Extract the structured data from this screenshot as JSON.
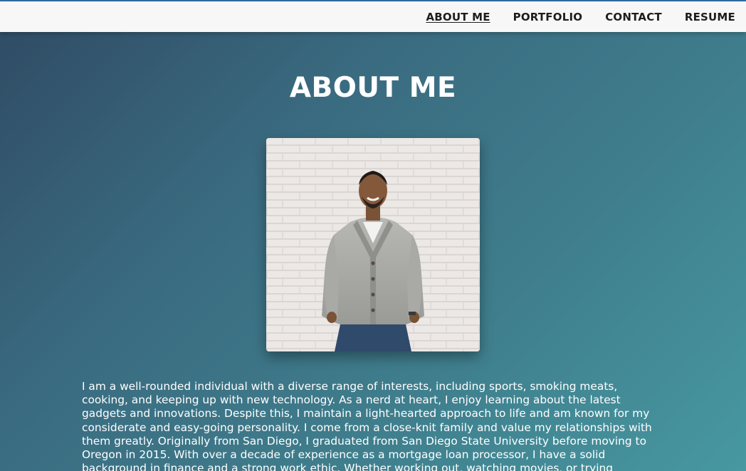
{
  "nav": {
    "items": [
      {
        "label": "ABOUT ME",
        "active": true
      },
      {
        "label": "PORTFOLIO",
        "active": false
      },
      {
        "label": "CONTACT",
        "active": false
      },
      {
        "label": "RESUME",
        "active": false
      }
    ]
  },
  "main": {
    "title": "ABOUT ME",
    "bio": "I am a well-rounded individual with a diverse range of interests, including sports, smoking meats, cooking, and keeping up with new technology. As a nerd at heart, I enjoy learning about the latest gadgets and innovations. Despite this, I maintain a light-hearted approach to life and am known for my considerate and easy-going personality. I come from a close-knit family and value my relationships with them greatly. Originally from San Diego, I graduated from San Diego State University before moving to Oregon in 2015. With over a decade of experience as a mortgage loan processor, I have a solid background in finance and a strong work ethic. Whether working out, watching movies, or trying"
  },
  "colors": {
    "nav_bg": "#f7f7f7",
    "accent_line": "#2f6fa6",
    "gradient_start": "#2f4a63",
    "gradient_end": "#4798a1",
    "text_light": "#ffffff"
  }
}
